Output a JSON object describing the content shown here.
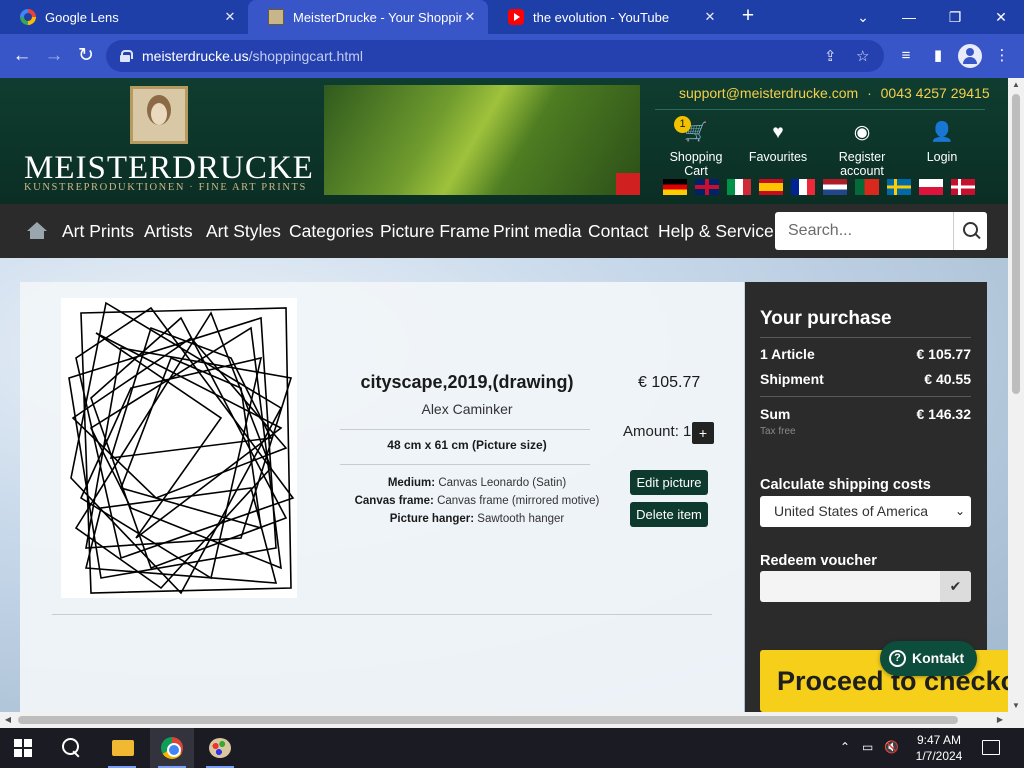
{
  "browser": {
    "tabs": [
      {
        "title": "Google Lens",
        "favicon": "google-lens-icon"
      },
      {
        "title": "MeisterDrucke - Your Shopping",
        "favicon": "meisterdrucke-icon",
        "active": true
      },
      {
        "title": "the evolution - YouTube",
        "favicon": "youtube-icon"
      }
    ],
    "url_host": "meisterdrucke.us",
    "url_path": "/shoppingcart.html"
  },
  "header": {
    "logo_name": "MEISTERDRUCKE",
    "logo_tagline": "KUNSTREPRODUKTIONEN · FINE ART PRINTS",
    "support_email": "support@meisterdrucke.com",
    "separator": "·",
    "phone": "0043 4257 29415",
    "cart_count": "1",
    "links": {
      "cart": "Shopping Cart",
      "favourites": "Favourites",
      "register": "Register account",
      "login": "Login"
    },
    "flags": [
      "de",
      "gb",
      "it",
      "es",
      "fr",
      "nl",
      "pt",
      "se",
      "pl",
      "dk"
    ]
  },
  "nav": {
    "items": [
      "Art Prints",
      "Artists",
      "Art Styles",
      "Categories",
      "Picture Frame",
      "Print media",
      "Contact",
      "Help & Service"
    ],
    "search_placeholder": "Search..."
  },
  "cart": {
    "item": {
      "title": "cityscape,2019,(drawing)",
      "artist": "Alex Caminker",
      "size": "48 cm x 61 cm (Picture size)",
      "medium_label": "Medium:",
      "medium_value": "Canvas Leonardo (Satin)",
      "frame_label": "Canvas frame:",
      "frame_value": "Canvas frame (mirrored motive)",
      "hanger_label": "Picture hanger:",
      "hanger_value": "Sawtooth hanger",
      "price": "€ 105.77",
      "amount_label": "Amount:",
      "amount": "1",
      "plus_label": "+",
      "edit_label": "Edit picture",
      "delete_label": "Delete item"
    }
  },
  "summary": {
    "title": "Your purchase",
    "articles_label": "1 Article",
    "articles_value": "€ 105.77",
    "shipment_label": "Shipment",
    "shipment_value": "€ 40.55",
    "sum_label": "Sum",
    "sum_value": "€ 146.32",
    "tax_note": "Tax free",
    "shipping_title": "Calculate shipping costs",
    "country": "United States of America",
    "voucher_title": "Redeem voucher",
    "voucher_value": "",
    "checkout_label": "Proceed to checkout",
    "contact_label": "Kontakt"
  },
  "taskbar": {
    "time": "9:47 AM",
    "date": "1/7/2024"
  },
  "colors": {
    "header_green": "#0f3d30",
    "nav_dark": "#2b2b2b",
    "checkout_yellow": "#f5cf1a",
    "browser_blue": "#3956c9"
  }
}
